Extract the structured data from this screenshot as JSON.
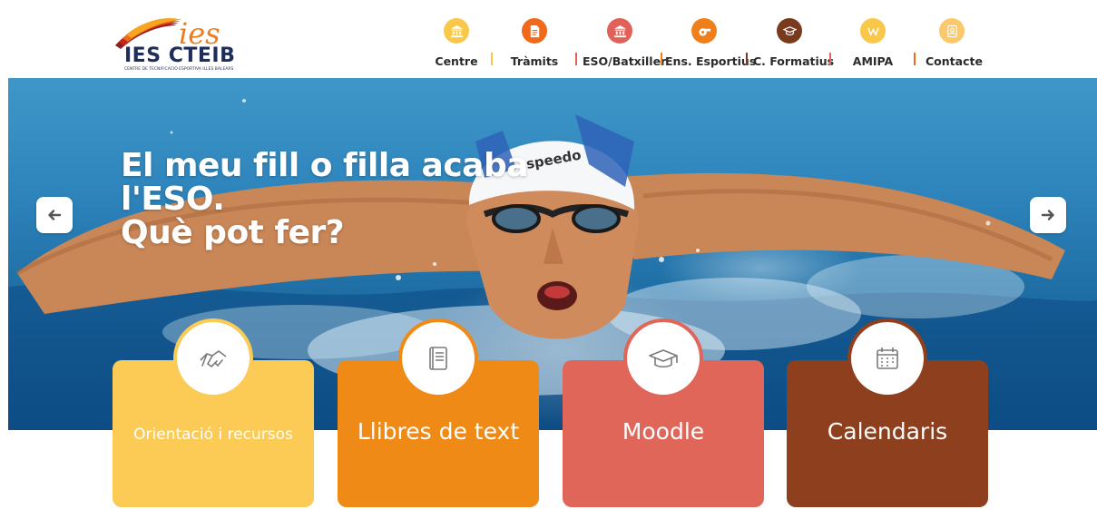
{
  "site": {
    "logo_letters": "ies",
    "logo_name": "IES CTEIB",
    "logo_subtitle": "CENTRE DE TECNIFICACIÓ ESPORTIVA ILLES BALEARS"
  },
  "nav": {
    "items": [
      {
        "label": "Centre",
        "icon": "institution-icon",
        "color": "#f9c84a"
      },
      {
        "label": "Tràmits",
        "icon": "document-icon",
        "color": "#ef6a1c"
      },
      {
        "label": "ESO/Batxiller",
        "icon": "institution-icon",
        "color": "#e06158"
      },
      {
        "label": "Ens. Esportius",
        "icon": "whistle-icon",
        "color": "#ef7f1a"
      },
      {
        "label": "C. Formatius",
        "icon": "graduation-cap-icon",
        "color": "#7a3a1e"
      },
      {
        "label": "AMIPA",
        "icon": "family-icon",
        "color": "#f9c84a"
      },
      {
        "label": "Contacte",
        "icon": "contact-card-icon",
        "color": "#fbc86a"
      }
    ]
  },
  "hero": {
    "title_line1": "El meu fill o filla acaba l'ESO.",
    "title_line2": "Què pot fer?",
    "cap_text": "speedo"
  },
  "cards": [
    {
      "label": "Orientació i recursos",
      "icon": "handshake-icon",
      "color": "#fccb56"
    },
    {
      "label": "Llibres de text",
      "icon": "book-icon",
      "color": "#f08a16"
    },
    {
      "label": "Moodle",
      "icon": "graduation-cap-icon",
      "color": "#e0665a"
    },
    {
      "label": "Calendaris",
      "icon": "calendar-icon",
      "color": "#8e3f1d"
    }
  ]
}
